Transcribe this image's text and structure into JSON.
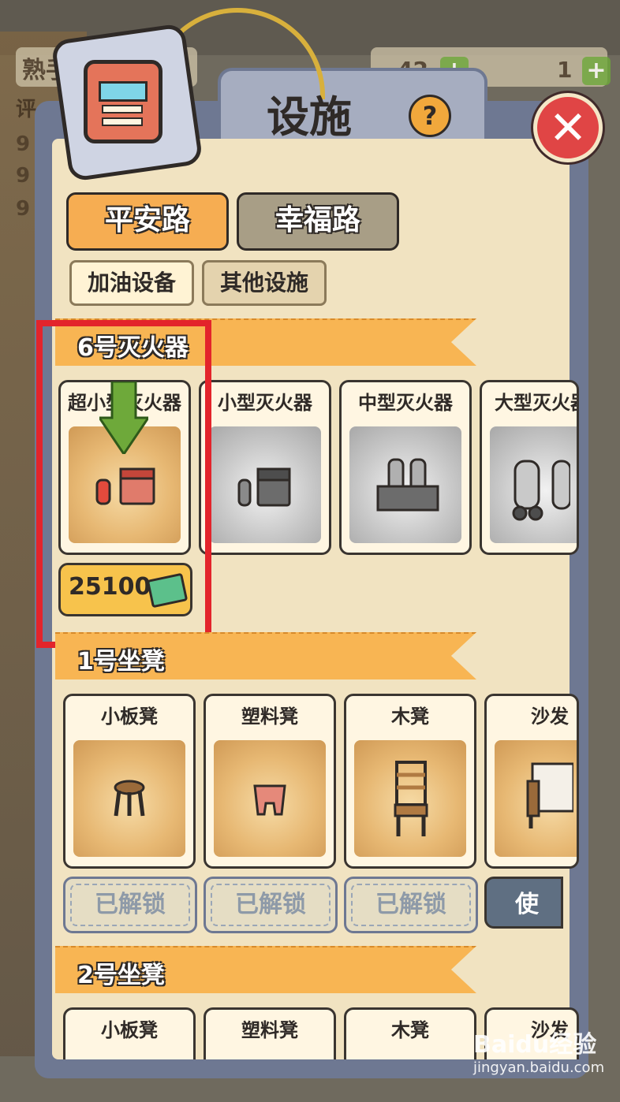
{
  "hud": {
    "rank_label": "熟手",
    "rank_sub": "评",
    "coins": "42",
    "gems": "1",
    "side_values": [
      "9",
      "9",
      "9"
    ]
  },
  "dialog": {
    "title": "设施",
    "help_label": "?",
    "close_label": "✕"
  },
  "road_tabs": [
    {
      "label": "平安路",
      "active": true
    },
    {
      "label": "幸福路",
      "active": false
    }
  ],
  "category_tabs": [
    {
      "label": "加油设备",
      "active": true
    },
    {
      "label": "其他设施",
      "active": false
    }
  ],
  "sections": [
    {
      "title": "6号灭火器",
      "items": [
        {
          "label": "超小型灭火器",
          "state": "available",
          "icon": "small-extinguisher-icon"
        },
        {
          "label": "小型灭火器",
          "state": "locked",
          "icon": "extinguisher-cart-icon"
        },
        {
          "label": "中型灭火器",
          "state": "locked",
          "icon": "extinguisher-rack-icon"
        },
        {
          "label": "大型灭火器",
          "state": "locked",
          "icon": "large-extinguisher-icon"
        }
      ],
      "price": "25100"
    },
    {
      "title": "1号坐凳",
      "items": [
        {
          "label": "小板凳",
          "status": "已解锁",
          "icon": "stool-icon"
        },
        {
          "label": "塑料凳",
          "status": "已解锁",
          "icon": "plastic-stool-icon"
        },
        {
          "label": "木凳",
          "status": "已解锁",
          "icon": "wooden-chair-icon"
        },
        {
          "label": "沙发",
          "status": "使用",
          "icon": "sofa-icon"
        }
      ]
    },
    {
      "title": "2号坐凳",
      "items": [
        {
          "label": "小板凳"
        },
        {
          "label": "塑料凳"
        },
        {
          "label": "木凳"
        },
        {
          "label": "沙发"
        }
      ]
    }
  ],
  "watermark": {
    "brand": "Baidu经验",
    "url": "jingyan.baidu.com"
  },
  "colors": {
    "panel_frame": "#6e7892",
    "panel_bg": "#f1e3c1",
    "ribbon": "#f8b553",
    "active_tab": "#f6ad52",
    "highlight": "#e3242b"
  }
}
